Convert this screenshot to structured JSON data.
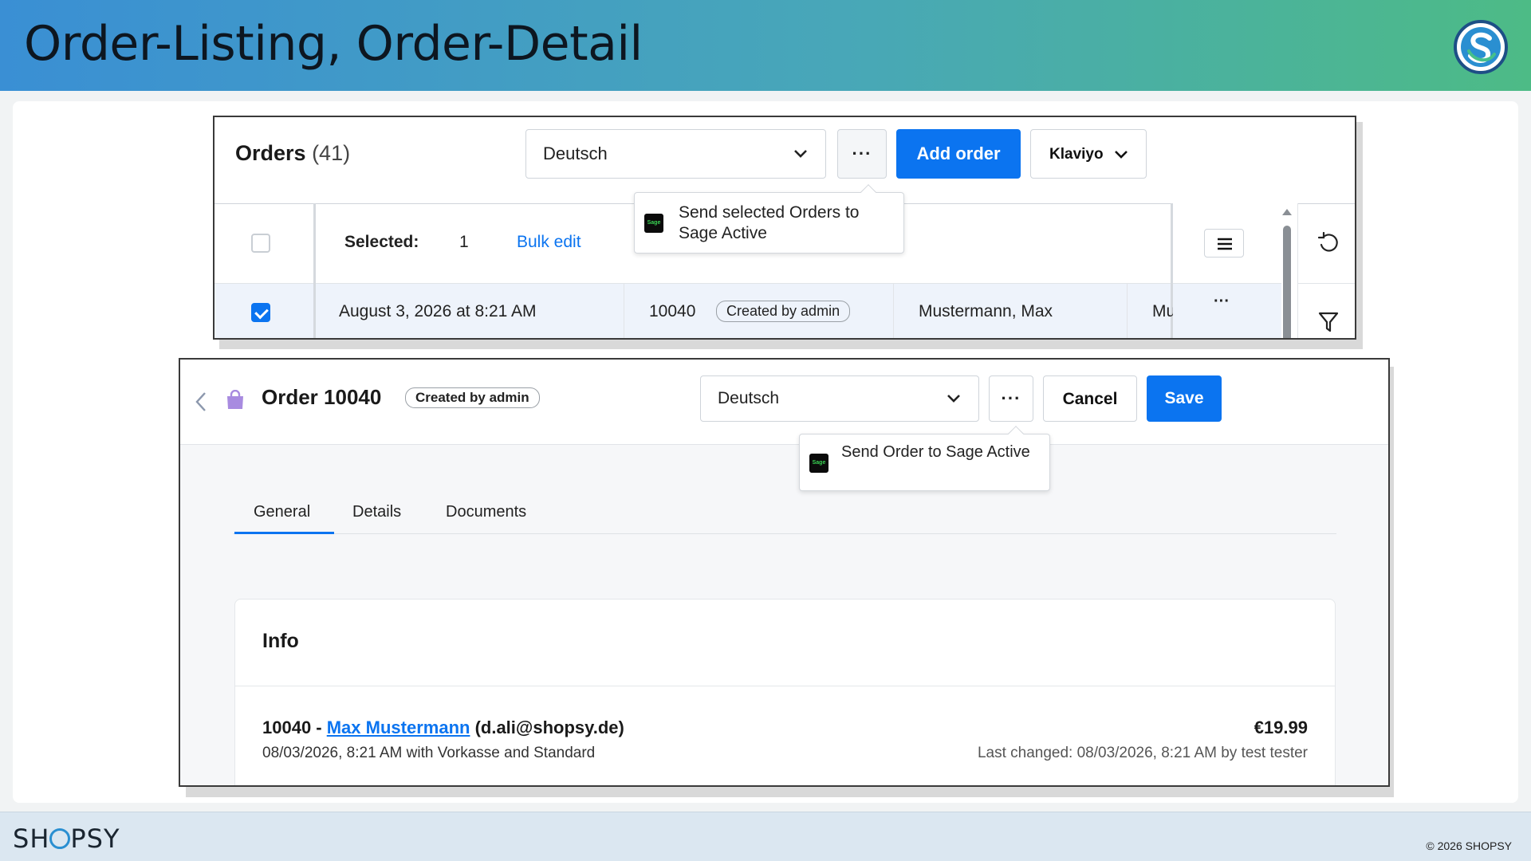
{
  "header": {
    "title": "Order-Listing, Order-Detail"
  },
  "footer": {
    "brand_left": "SH",
    "brand_right": "PSY",
    "copyright": "© 2026 SHOPSY"
  },
  "colors": {
    "accent": "#0b74f0",
    "banner_start": "#3a8fd4",
    "banner_end": "#4dbb86"
  },
  "orders": {
    "title": "Orders",
    "count": "(41)",
    "language": "Deutsch",
    "more_label": "···",
    "add_order": "Add order",
    "klaviyo": "Klaviyo",
    "popover_text": "Send selected Orders to Sage Active",
    "selected_label": "Selected:",
    "selected_count": "1",
    "bulk_edit": "Bulk edit",
    "row": {
      "date": "August 3, 2026 at 8:21 AM",
      "order_no": "10040",
      "badge": "Created by admin",
      "customer": "Mustermann, Max",
      "truncated": "Mu",
      "row_more": "···",
      "checked": true
    }
  },
  "detail": {
    "title": "Order 10040",
    "badge": "Created by admin",
    "language": "Deutsch",
    "more_label": "···",
    "cancel": "Cancel",
    "save": "Save",
    "popover_text": "Send Order to Sage Active",
    "tabs": [
      {
        "label": "General",
        "active": true
      },
      {
        "label": "Details",
        "active": false
      },
      {
        "label": "Documents",
        "active": false
      }
    ],
    "info": {
      "title": "Info",
      "order_prefix": "10040 - ",
      "customer_name": "Max Mustermann",
      "customer_email": " (d.ali@shopsy.de)",
      "meta": "08/03/2026, 8:21 AM with Vorkasse and Standard",
      "price": "€19.99",
      "last_changed": "Last changed: 08/03/2026, 8:21 AM by test tester"
    }
  },
  "icons": [
    "shopsy-logo-icon",
    "chevron-down-icon",
    "more-icon",
    "sage-icon",
    "list-menu-icon",
    "refresh-icon",
    "filter-icon",
    "back-chevron-icon",
    "shopping-bag-icon"
  ]
}
